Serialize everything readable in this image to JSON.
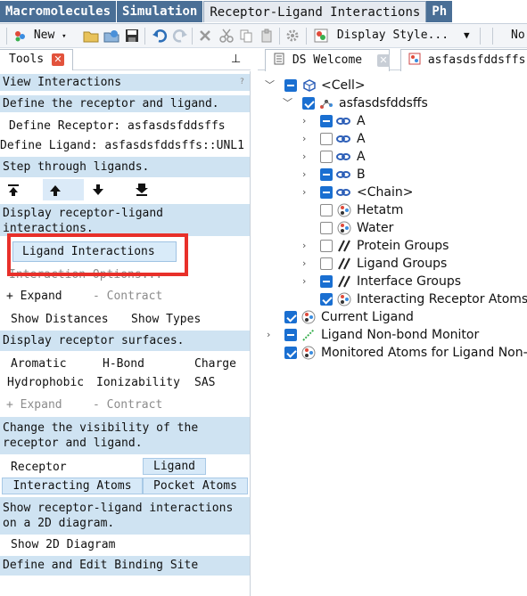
{
  "menu_tabs": [
    "Macromolecules",
    "Simulation",
    "Receptor-Ligand Interactions",
    "Ph"
  ],
  "toolbar": {
    "new_label": "New",
    "display_style_label": "Display Style...",
    "overflow_label": "No"
  },
  "tools_panel": {
    "tab_label": "Tools",
    "sections": {
      "view_interactions": "View Interactions",
      "define": "Define the receptor and ligand.",
      "step": "Step through ligands.",
      "display": "Display receptor-ligand interactions.",
      "surfaces": "Display receptor surfaces.",
      "visibility": "Change the visibility of the receptor and ligand.",
      "diagram": "Show receptor-ligand interactions on a 2D diagram.",
      "binding_site": "Define and Edit Binding Site"
    },
    "define_receptor": "Define Receptor: asfasdsfddsffs",
    "define_ligand": "Define Ligand: asfasdsfddsffs::UNL1",
    "ligand_interactions_button": "Ligand Interactions",
    "interaction_options": "Interaction Options...",
    "expand": "+ Expand",
    "contract": "- Contract",
    "show_distances": "Show Distances",
    "show_types": "Show Types",
    "surfaces": {
      "aromatic": "Aromatic",
      "hbond": "H-Bond",
      "charge": "Charge",
      "hydrophobic": "Hydrophobic",
      "ionizability": "Ionizability",
      "sas": "SAS"
    },
    "visibility": {
      "receptor": "Receptor",
      "ligand": "Ligand",
      "interacting_atoms": "Interacting Atoms",
      "pocket_atoms": "Pocket Atoms"
    },
    "show_2d_diagram": "Show 2D Diagram"
  },
  "right_tabs": [
    "DS Welcome",
    "asfasdsfddsffs"
  ],
  "tree": {
    "cell": "<Cell>",
    "molecule": "asfasdsfddsffs",
    "chains": [
      "A",
      "A",
      "A",
      "B",
      "<Chain>"
    ],
    "hetatm": "Hetatm",
    "water": "Water",
    "protein_groups": "Protein Groups",
    "ligand_groups": "Ligand Groups",
    "interface_groups": "Interface Groups",
    "interacting_receptor_atoms": "Interacting Receptor Atoms",
    "current_ligand": "Current Ligand",
    "nonbond_monitor": "Ligand Non-bond Monitor",
    "monitored_atoms": "Monitored Atoms for Ligand Non-bond Monitor"
  },
  "colors": {
    "menu_tab": "#4a6f96",
    "section_bg": "#cfe3f2",
    "checkbox_blue": "#1a6fd1",
    "highlight_red": "#e8302a"
  }
}
